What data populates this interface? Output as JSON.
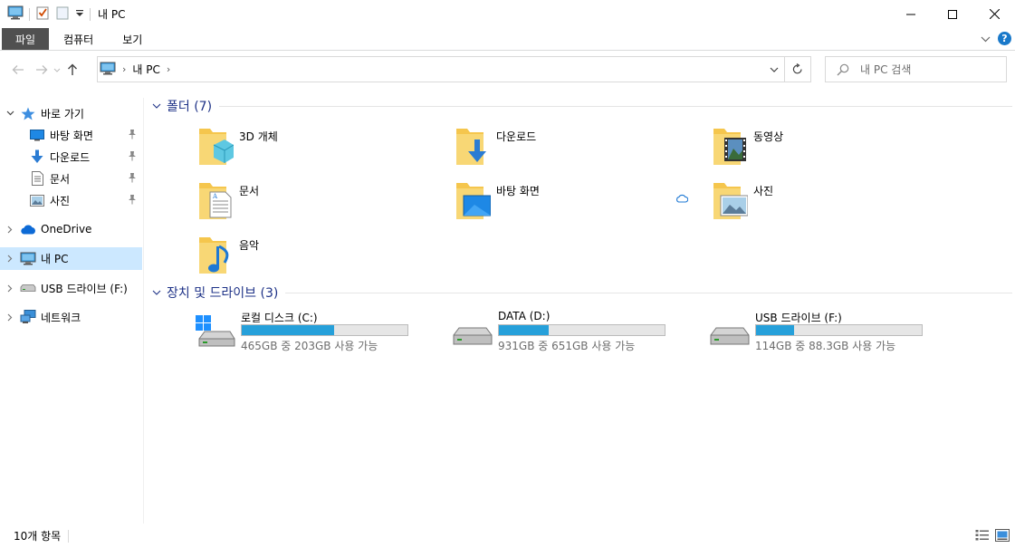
{
  "window": {
    "title": "내 PC"
  },
  "ribbon": {
    "tabs": [
      "파일",
      "컴퓨터",
      "보기"
    ],
    "help_label": "?"
  },
  "address": {
    "crumbs": [
      "내 PC"
    ],
    "search_placeholder": "내 PC 검색"
  },
  "nav": {
    "items": [
      {
        "label": "바로 가기",
        "icon": "star-icon",
        "expanded": true
      },
      {
        "label": "바탕 화면",
        "icon": "desktop-icon",
        "pinned": true
      },
      {
        "label": "다운로드",
        "icon": "download-icon",
        "pinned": true
      },
      {
        "label": "문서",
        "icon": "document-icon",
        "pinned": true
      },
      {
        "label": "사진",
        "icon": "pictures-icon",
        "pinned": true
      },
      {
        "label": "OneDrive",
        "icon": "onedrive-icon"
      },
      {
        "label": "내 PC",
        "icon": "pc-icon",
        "selected": true
      },
      {
        "label": "USB 드라이브 (F:)",
        "icon": "usb-drive-icon"
      },
      {
        "label": "네트워크",
        "icon": "network-icon"
      }
    ]
  },
  "groups": {
    "folders": {
      "title": "폴더 (7)"
    },
    "drives": {
      "title": "장치 및 드라이브 (3)"
    }
  },
  "folders": [
    {
      "label": "3D 개체",
      "icon": "3d-objects-folder-icon"
    },
    {
      "label": "다운로드",
      "icon": "downloads-folder-icon"
    },
    {
      "label": "동영상",
      "icon": "videos-folder-icon"
    },
    {
      "label": "문서",
      "icon": "documents-folder-icon"
    },
    {
      "label": "바탕 화면",
      "icon": "desktop-folder-icon"
    },
    {
      "label": "사진",
      "icon": "pictures-folder-icon"
    },
    {
      "label": "음악",
      "icon": "music-folder-icon"
    }
  ],
  "drives": [
    {
      "name": "로컬 디스크 (C:)",
      "free_text": "465GB 중 203GB 사용 가능",
      "used_fraction": 0.56,
      "icon": "windows-drive-icon"
    },
    {
      "name": "DATA (D:)",
      "free_text": "931GB 중 651GB 사용 가능",
      "used_fraction": 0.3,
      "icon": "hard-drive-icon"
    },
    {
      "name": "USB 드라이브 (F:)",
      "free_text": "114GB 중 88.3GB 사용 가능",
      "used_fraction": 0.23,
      "icon": "usb-drive-icon"
    }
  ],
  "status": {
    "item_count": "10개 항목"
  },
  "colors": {
    "accent": "#26a0da",
    "selection": "#cce8ff",
    "group_title": "#1e3287",
    "folder": "#f8d775"
  }
}
